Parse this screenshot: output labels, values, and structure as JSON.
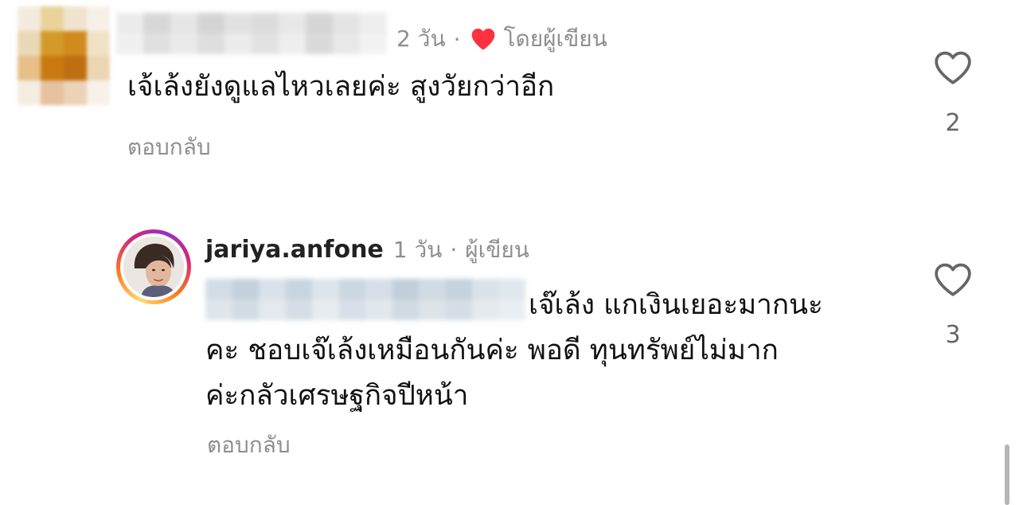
{
  "colors": {
    "meta_gray": "#8e8e8e",
    "text": "#111111",
    "heart_red": "#ff3040",
    "outline_gray": "#666666"
  },
  "comment_1": {
    "time": "2 วัน",
    "separator": "·",
    "liked_by_author_label": "โดยผู้เขียน",
    "text": "เจ้เล้งยังดูแลไหวเลยค่ะ สูงวัยกว่าอีก",
    "reply_label": "ตอบกลับ",
    "like_icon": "heart-outline-icon",
    "like_count": "2"
  },
  "comment_2": {
    "username": "jariya.anfone",
    "time": "1 วัน",
    "separator": "·",
    "author_label": "ผู้เขียน",
    "text_lines": [
      "เจ๊เล้ง แกเงินเยอะมากนะ",
      "คะ ชอบเจ๊เล้งเหมือนกันค่ะ พอดี ทุนทรัพย์ไม่มาก",
      "ค่ะกลัวเศรษฐกิจปีหน้า"
    ],
    "reply_label": "ตอบกลับ",
    "like_icon": "heart-outline-icon",
    "like_count": "3"
  }
}
